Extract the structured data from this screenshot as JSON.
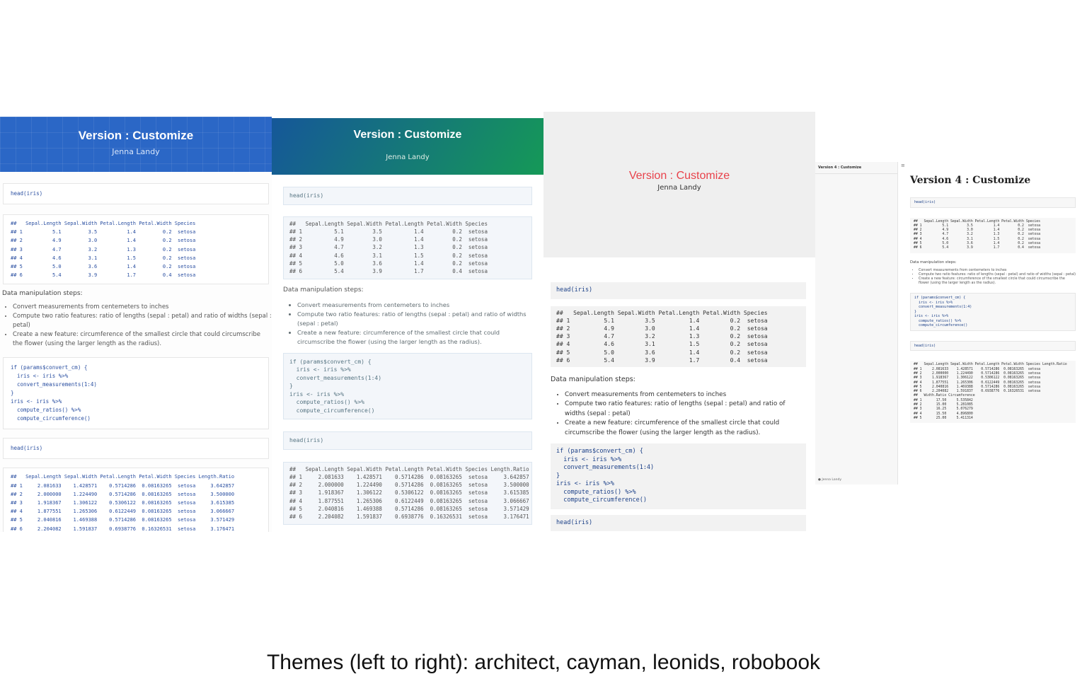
{
  "caption": "Themes (left to right): architect, cayman, leonids, robobook",
  "doc": {
    "title": "Version : Customize",
    "author": "Jenna Landy",
    "robobook_title": "Version 4 : Customize",
    "robobook_nav": "Version 4 : Customize",
    "robobook_menu": "≡",
    "code_head": "head(iris)",
    "code_transform": "if (params$convert_cm) {\n  iris <- iris %>%\n  convert_measurements(1:4)\n}\niris <- iris %>%\n  compute_ratios() %>%\n  compute_circumference()",
    "out_iris": "##   Sepal.Length Sepal.Width Petal.Length Petal.Width Species\n## 1          5.1         3.5          1.4         0.2  setosa\n## 2          4.9         3.0          1.4         0.2  setosa\n## 3          4.7         3.2          1.3         0.2  setosa\n## 4          4.6         3.1          1.5         0.2  setosa\n## 5          5.0         3.6          1.4         0.2  setosa\n## 6          5.4         3.9          1.7         0.4  setosa",
    "out_ratios": "##   Sepal.Length Sepal.Width Petal.Length Petal.Width Species Length.Ratio\n## 1     2.081633    1.428571    0.5714286  0.08163265  setosa     3.642857\n## 2     2.000000    1.224490    0.5714286  0.08163265  setosa     3.500000\n## 3     1.918367    1.306122    0.5306122  0.08163265  setosa     3.615385\n## 4     1.877551    1.265306    0.6122449  0.08163265  setosa     3.066667\n## 5     2.040816    1.469388    0.5714286  0.08163265  setosa     3.571429\n## 6     2.204082    1.591837    0.6938776  0.16326531  setosa     3.176471",
    "out_robobook": "##   Sepal.Length Sepal.Width Petal.Length Petal.Width Species Length.Ratio\n## 1     2.081633    1.428571    0.5714286  0.08163265  setosa\n## 2     2.000000    1.224490    0.5714286  0.08163265  setosa\n## 3     1.918367    1.306122    0.5306122  0.08163265  setosa\n## 4     1.877551    1.265306    0.6122449  0.08163265  setosa\n## 5     2.040816    1.469388    0.5714286  0.08163265  setosa\n## 6     2.204082    1.591837    0.6938776  0.16326531  setosa\n##   Width.Ratio Circumference\n## 1       17.50     5.535842\n## 2       15.00     5.281085\n## 3       16.25     5.076279\n## 4       15.50     4.896800\n## 5       25.00     5.411314",
    "steps_heading": "Data manipulation steps:",
    "steps": [
      "Convert measurements from centemeters to inches",
      "Compute two ratio features: ratio of lengths (sepal : petal) and ratio of widths (sepal : petal)",
      "Create a new feature: circumference of the smallest circle that could circumscribe the flower (using the larger length as the radius)."
    ]
  }
}
